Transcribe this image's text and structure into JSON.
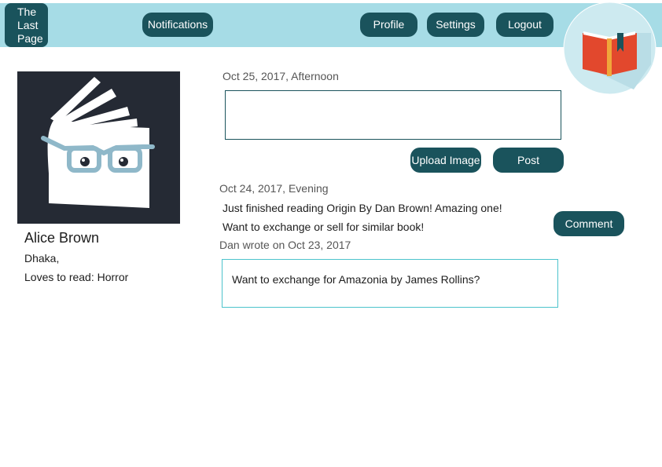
{
  "app": {
    "logo_lines": [
      "The",
      "Last",
      "Page"
    ]
  },
  "nav": {
    "notifications": "Notifications",
    "profile": "Profile",
    "settings": "Settings",
    "logout": "Logout"
  },
  "profile": {
    "name": "Alice Brown",
    "location": "Dhaka,",
    "loves": "Loves to read: Horror"
  },
  "composer": {
    "timestamp": "Oct 25, 2017, Afternoon",
    "input_value": "",
    "upload_label": "Upload Image",
    "post_label": "Post"
  },
  "feed": {
    "post": {
      "timestamp": "Oct 24, 2017, Evening",
      "lines": [
        "Just finished reading Origin By Dan Brown! Amazing one!",
        "Want to exchange or sell for similar book!"
      ],
      "comment_label": "Comment"
    },
    "comment": {
      "header": "Dan wrote on Oct 23, 2017",
      "text": "Want to exchange for Amazonia by James Rollins?"
    }
  },
  "colors": {
    "topbar": "#a6dce6",
    "button": "#1a535c",
    "avatar_bg": "#252a34",
    "book_red": "#e2482d",
    "comment_border": "#4cc3cc"
  }
}
